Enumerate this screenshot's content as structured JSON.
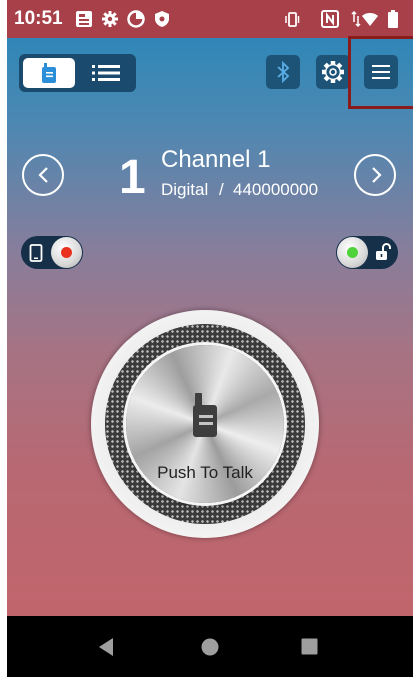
{
  "status_bar": {
    "time": "10:51",
    "icons": [
      "app-notification-icon",
      "settings-notification-icon",
      "data-saver-icon",
      "shield-icon",
      "vibrate-icon",
      "nfc-icon",
      "wifi-icon",
      "battery-icon"
    ]
  },
  "toolbar": {
    "view_toggle": [
      "walkie-talkie-view-icon",
      "list-view-icon"
    ],
    "active_view": "walkie-talkie-view",
    "buttons": [
      "bluetooth-icon",
      "gear-icon",
      "menu-icon"
    ]
  },
  "channel": {
    "number": "1",
    "name": "Channel 1",
    "mode": "Digital",
    "separator": "/",
    "frequency": "440000000"
  },
  "switches": {
    "left": {
      "icon": "phone-icon",
      "indicator_color": "#e8321e"
    },
    "right": {
      "icon": "unlock-icon",
      "indicator_color": "#4fd23a"
    }
  },
  "ptt": {
    "label": "Push To Talk",
    "icon": "walkie-talkie-icon"
  },
  "nav_bar": [
    "back-icon",
    "home-icon",
    "recents-icon"
  ],
  "colors": {
    "status_bar": "#a8404a",
    "accent_button": "#1e5378",
    "highlight_frame": "#8b1a1a"
  }
}
